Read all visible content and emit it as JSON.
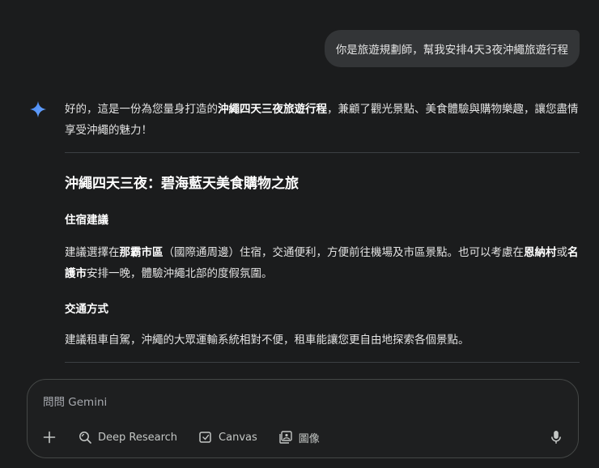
{
  "user_message": "你是旅遊規劃師，幫我安排4天3夜沖繩旅遊行程",
  "response": {
    "intro_1": "好的，這是一份為您量身打造的",
    "intro_bold": "沖繩四天三夜旅遊行程",
    "intro_2": "，兼顧了觀光景點、美食體驗與購物樂趣，讓您盡情享受沖繩的魅力！",
    "title": "沖繩四天三夜：碧海藍天美食購物之旅",
    "lodging_heading": "住宿建議",
    "lodging_1": "建議選擇在",
    "lodging_bold_1": "那霸市區",
    "lodging_2": "（國際通周邊）住宿，交通便利，方便前往機場及市區景點。也可以考慮在",
    "lodging_bold_2": "恩納村",
    "lodging_3": "或",
    "lodging_bold_3": "名護市",
    "lodging_4": "安排一晚，體驗沖繩北部的度假氛圍。",
    "transport_heading": "交通方式",
    "transport_text": "建議租車自駕，沖繩的大眾運輸系統相對不便，租車能讓您更自由地探索各個景點。"
  },
  "input": {
    "placeholder": "問問 Gemini",
    "tools": {
      "deep_research": "Deep Research",
      "canvas": "Canvas",
      "image": "圖像"
    }
  },
  "icons": {
    "assistant": "gemini-sparkle-icon",
    "add": "plus-icon",
    "deep_research": "research-icon",
    "canvas": "canvas-icon",
    "image": "image-icon",
    "mic": "mic-icon"
  },
  "colors": {
    "background": "#1b1c1d",
    "user_bubble": "#333537",
    "accent": "#4a8cf7"
  }
}
